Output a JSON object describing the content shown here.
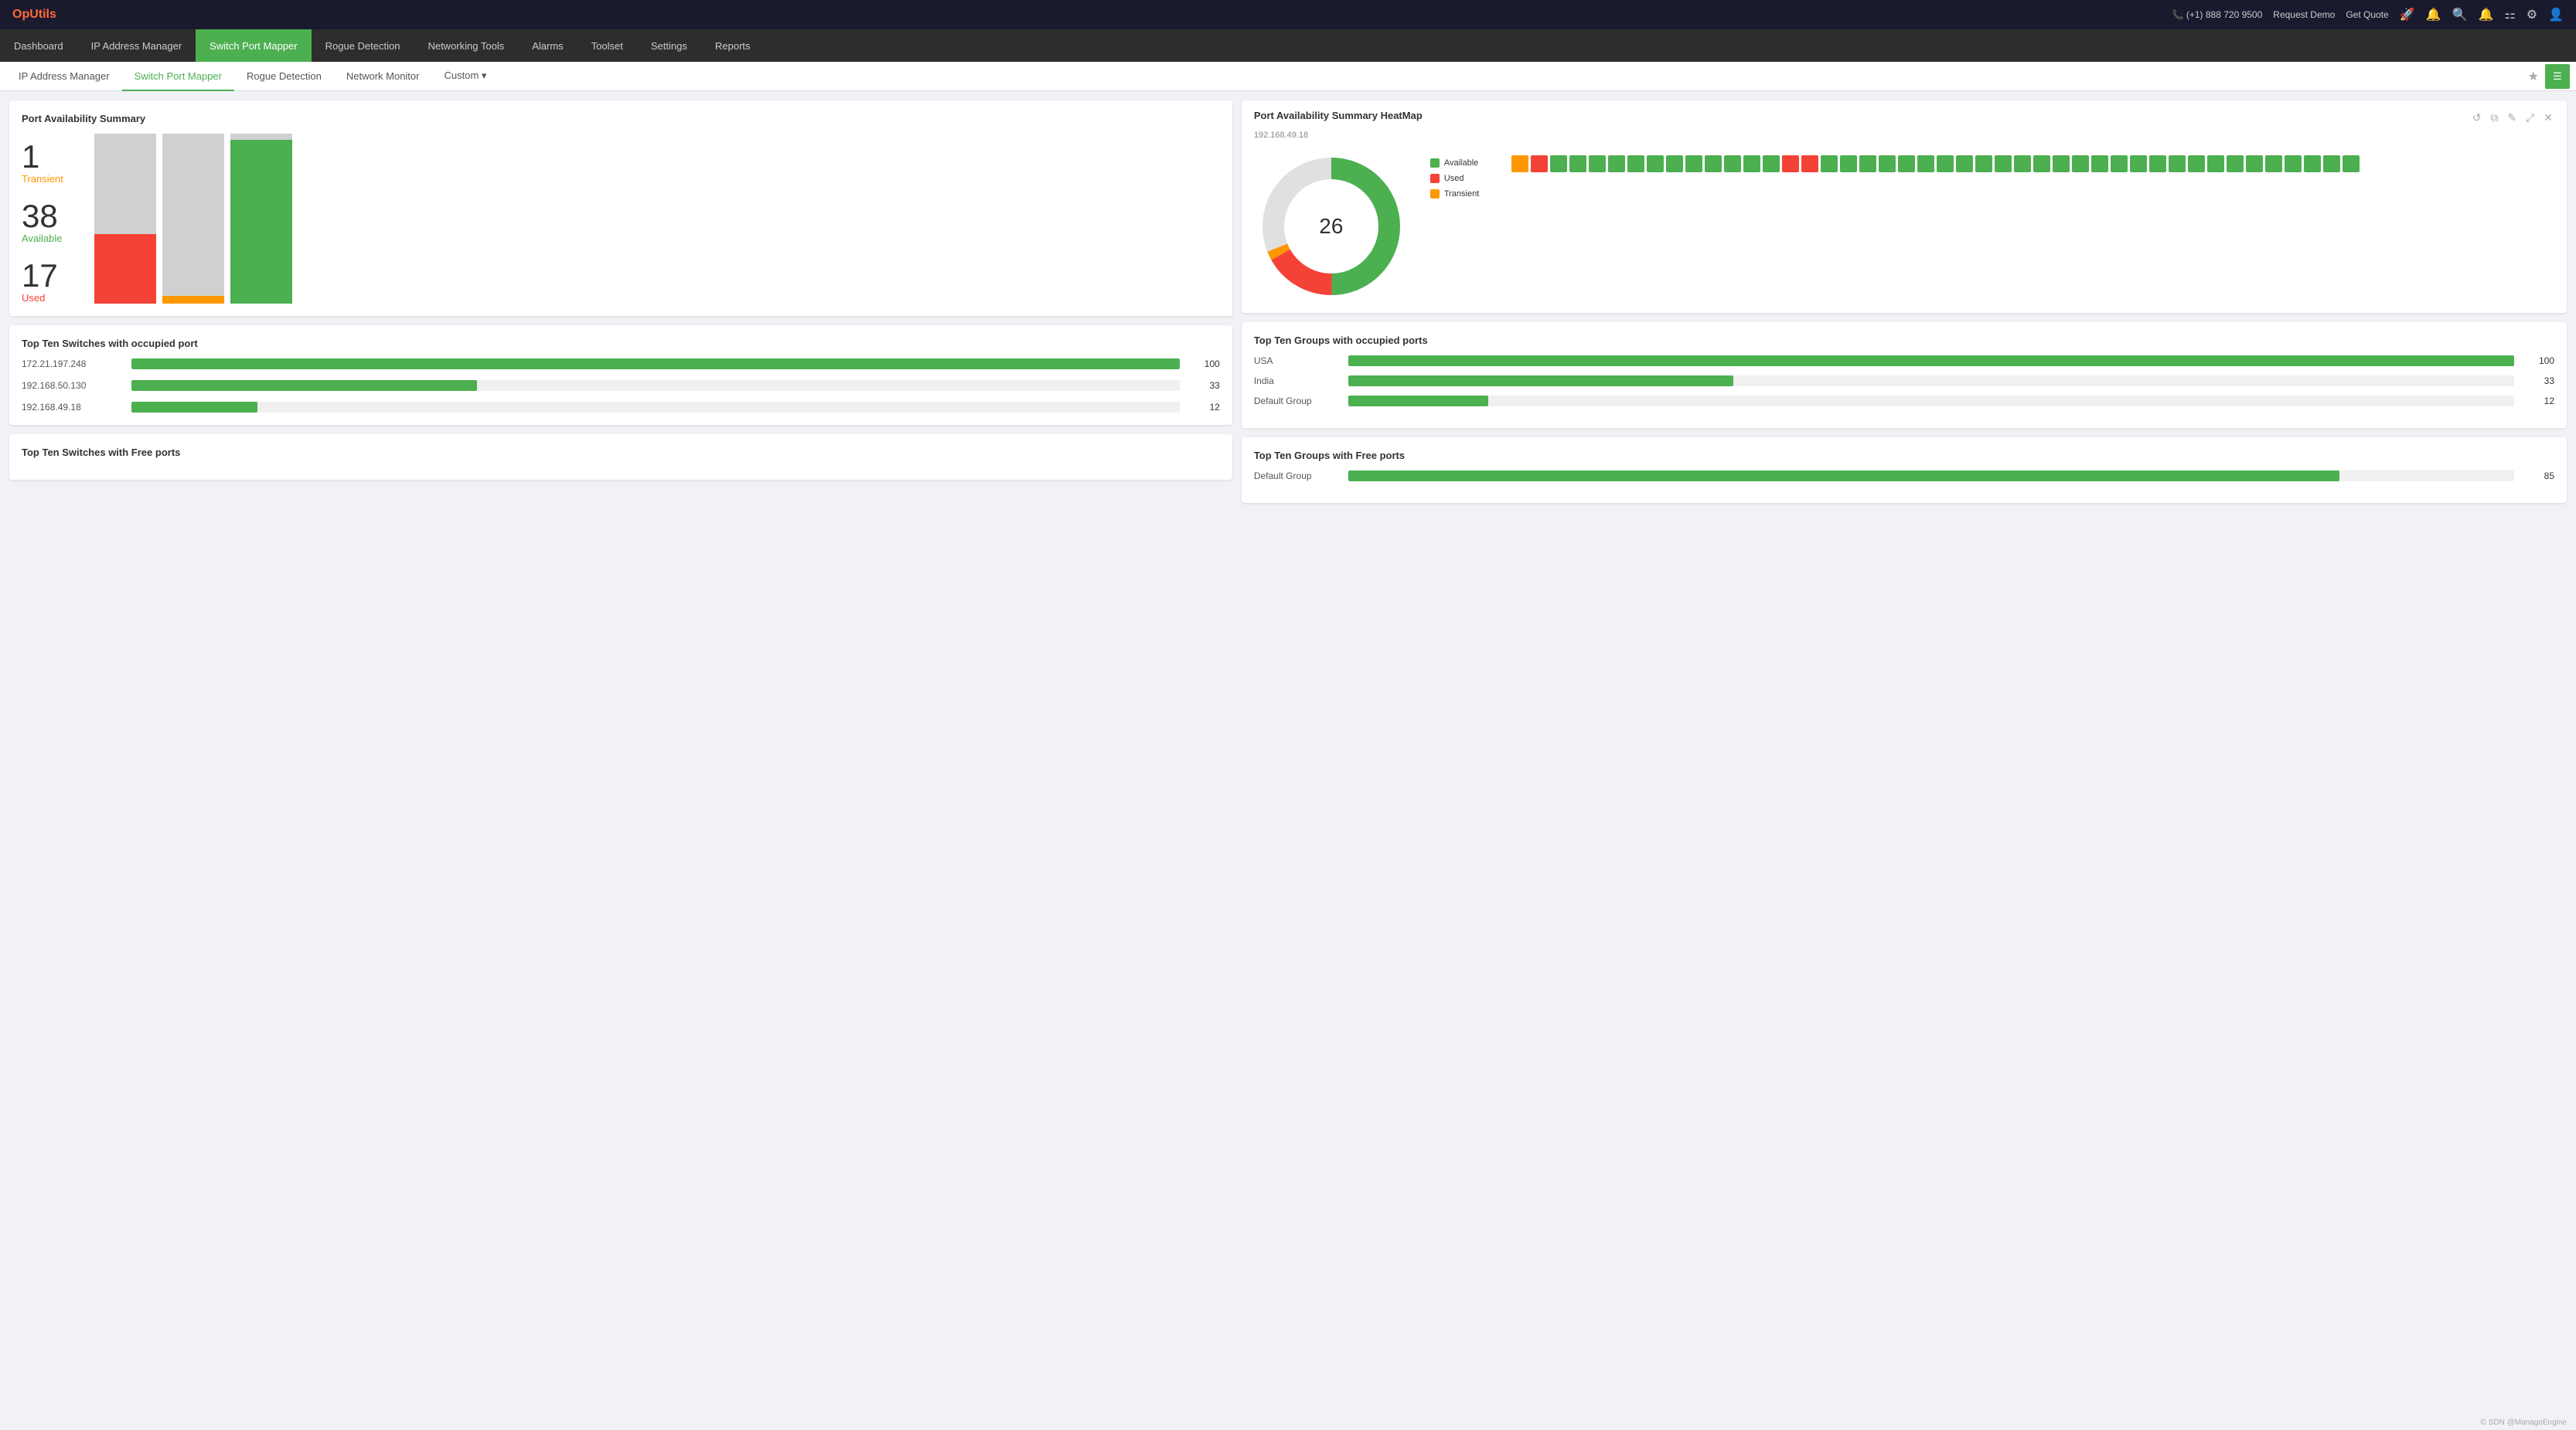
{
  "topbar": {
    "logo": "OpUtils",
    "phone": "(+1) 888 720 9500",
    "request_demo": "Request Demo",
    "get_quote": "Get Quote"
  },
  "main_nav": {
    "items": [
      {
        "id": "dashboard",
        "label": "Dashboard",
        "active": false
      },
      {
        "id": "ip-address-manager",
        "label": "IP Address Manager",
        "active": false
      },
      {
        "id": "switch-port-mapper",
        "label": "Switch Port Mapper",
        "active": true
      },
      {
        "id": "rogue-detection",
        "label": "Rogue Detection",
        "active": false
      },
      {
        "id": "networking-tools",
        "label": "Networking Tools",
        "active": false
      },
      {
        "id": "alarms",
        "label": "Alarms",
        "active": false
      },
      {
        "id": "toolset",
        "label": "Toolset",
        "active": false
      },
      {
        "id": "settings",
        "label": "Settings",
        "active": false
      },
      {
        "id": "reports",
        "label": "Reports",
        "active": false
      }
    ]
  },
  "sub_nav": {
    "items": [
      {
        "id": "ip-address-manager",
        "label": "IP Address Manager",
        "active": false
      },
      {
        "id": "switch-port-mapper",
        "label": "Switch Port Mapper",
        "active": true
      },
      {
        "id": "rogue-detection",
        "label": "Rogue Detection",
        "active": false
      },
      {
        "id": "network-monitor",
        "label": "Network Monitor",
        "active": false
      },
      {
        "id": "custom",
        "label": "Custom",
        "active": false
      }
    ]
  },
  "port_availability_summary": {
    "title": "Port Availability Summary",
    "transient_count": "1",
    "transient_label": "Transient",
    "available_count": "38",
    "available_label": "Available",
    "used_count": "17",
    "used_label": "Used"
  },
  "heatmap_card": {
    "title": "Port Availability Summary HeatMap",
    "subtitle": "192.168.49.18",
    "center_value": "26",
    "legend": {
      "available_label": "Available",
      "used_label": "Used",
      "transient_label": "Transient"
    }
  },
  "top_switches_occupied": {
    "title": "Top Ten Switches with occupied port",
    "items": [
      {
        "label": "172.21.197.248",
        "value": 100,
        "max": 100
      },
      {
        "label": "192.168.50.130",
        "value": 33,
        "max": 100
      },
      {
        "label": "192.168.49.18",
        "value": 12,
        "max": 100
      }
    ]
  },
  "top_switches_free": {
    "title": "Top Ten Switches with Free ports"
  },
  "top_groups_occupied": {
    "title": "Top Ten Groups with occupied ports",
    "items": [
      {
        "label": "USA",
        "value": 100,
        "max": 100
      },
      {
        "label": "India",
        "value": 33,
        "max": 100
      },
      {
        "label": "Default Group",
        "value": 12,
        "max": 100
      }
    ]
  },
  "top_groups_free": {
    "title": "Top Ten Groups with Free ports",
    "items": [
      {
        "label": "Default Group",
        "value": 85,
        "max": 100
      }
    ]
  },
  "footer": {
    "text": "© SDN @ManageEngine"
  },
  "heatmap_cells": {
    "row1": [
      "orange",
      "red",
      "green",
      "green",
      "green",
      "green",
      "green",
      "green",
      "green",
      "green",
      "green",
      "green",
      "green",
      "green",
      "red",
      "red",
      "green",
      "green",
      "green",
      "green",
      "green",
      "green",
      "green"
    ],
    "row2": [
      "green",
      "green",
      "green",
      "green",
      "green",
      "green",
      "green",
      "green",
      "green",
      "green",
      "green",
      "green",
      "green",
      "green",
      "green",
      "green",
      "green",
      "green",
      "green",
      "green",
      "green"
    ]
  },
  "colors": {
    "green": "#4caf50",
    "red": "#f44336",
    "orange": "#ff9800",
    "available": "#4caf50",
    "used": "#f44336",
    "transient": "#ff9800",
    "gray": "#d0d0d0"
  }
}
